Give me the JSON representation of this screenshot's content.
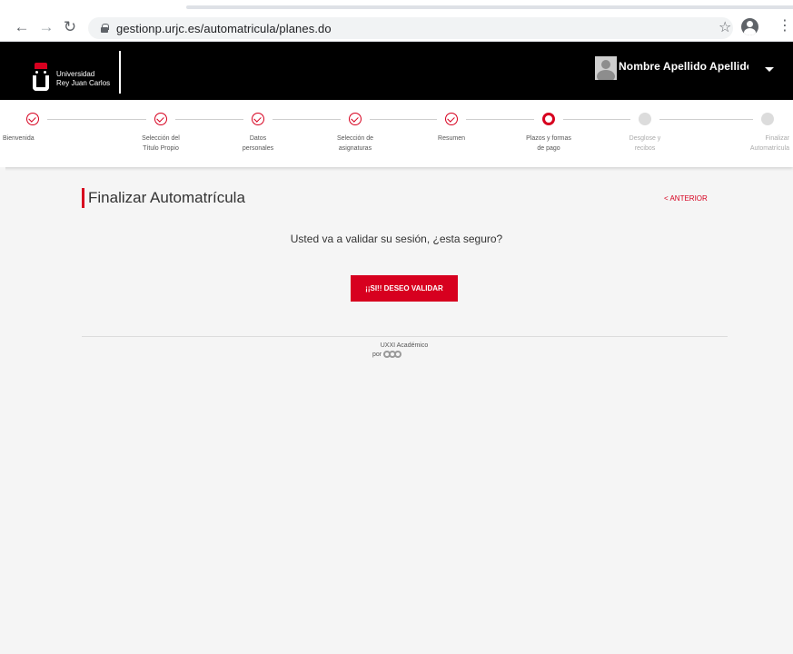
{
  "browser": {
    "url": "gestionp.urjc.es/automatricula/planes.do"
  },
  "header": {
    "logo_line1": "Universidad",
    "logo_line2": "Rey Juan Carlos",
    "user_name": "Nombre Apellido Apellido"
  },
  "colors": {
    "accent": "#d7001f",
    "header_bg": "#000000",
    "page_bg": "#f5f5f5"
  },
  "steps": [
    {
      "line1": "Bienvenida",
      "line2": "",
      "status": "done"
    },
    {
      "line1": "Selección del",
      "line2": "Título Propio",
      "status": "done"
    },
    {
      "line1": "Datos",
      "line2": "personales",
      "status": "done"
    },
    {
      "line1": "Selección de",
      "line2": "asignaturas",
      "status": "done"
    },
    {
      "line1": "Resumen",
      "line2": "",
      "status": "done"
    },
    {
      "line1": "Plazos y formas",
      "line2": "de pago",
      "status": "current"
    },
    {
      "line1": "Desglose y",
      "line2": "recibos",
      "status": "pending"
    },
    {
      "line1": "Finalizar",
      "line2": "Automatrícula",
      "status": "pending"
    }
  ],
  "main": {
    "title": "Finalizar Automatrícula",
    "prev_link": "< ANTERIOR",
    "question": "Usted va a validar su sesión, ¿esta seguro?",
    "confirm_label": "¡¡SI!! DESEO VALIDAR"
  },
  "footer": {
    "product": "UXXI Académico",
    "por": "por"
  }
}
